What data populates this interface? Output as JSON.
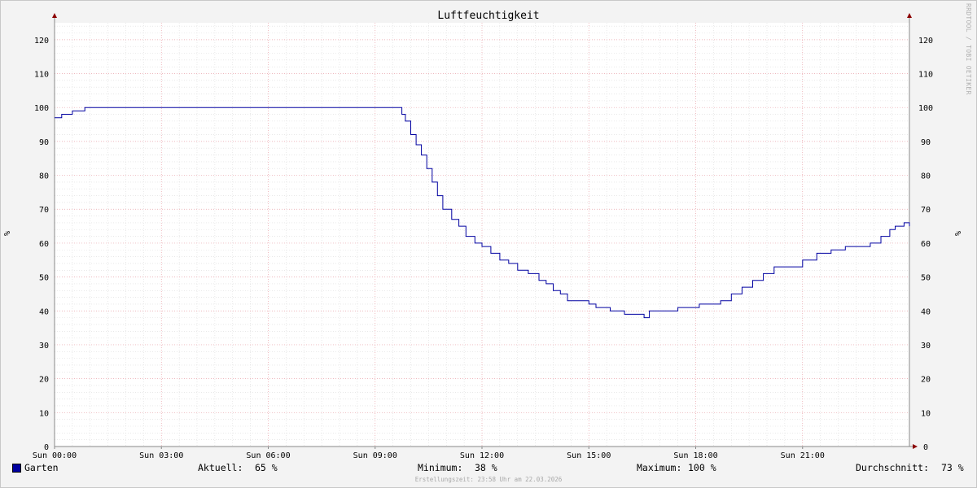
{
  "chart_data": {
    "type": "line",
    "title": "Luftfeuchtigkeit",
    "ylabel": "%",
    "ylabel_right": "%",
    "xlim_hours": [
      0,
      24
    ],
    "ylim": [
      0,
      125
    ],
    "yticks": [
      0,
      10,
      20,
      30,
      40,
      50,
      60,
      70,
      80,
      90,
      100,
      110,
      120
    ],
    "xticks": [
      {
        "hour": 0,
        "label": "Sun 00:00"
      },
      {
        "hour": 3,
        "label": "Sun 03:00"
      },
      {
        "hour": 6,
        "label": "Sun 06:00"
      },
      {
        "hour": 9,
        "label": "Sun 09:00"
      },
      {
        "hour": 12,
        "label": "Sun 12:00"
      },
      {
        "hour": 15,
        "label": "Sun 15:00"
      },
      {
        "hour": 18,
        "label": "Sun 18:00"
      },
      {
        "hour": 21,
        "label": "Sun 21:00"
      }
    ],
    "grid": true,
    "series": [
      {
        "name": "Garten",
        "color": "#0000a0",
        "points": [
          [
            0,
            97
          ],
          [
            0.15,
            97
          ],
          [
            0.2,
            98
          ],
          [
            0.45,
            98
          ],
          [
            0.5,
            99
          ],
          [
            0.8,
            99
          ],
          [
            0.85,
            100
          ],
          [
            9.65,
            100
          ],
          [
            9.75,
            98
          ],
          [
            9.85,
            96
          ],
          [
            10.0,
            92
          ],
          [
            10.15,
            89
          ],
          [
            10.3,
            86
          ],
          [
            10.45,
            82
          ],
          [
            10.6,
            78
          ],
          [
            10.75,
            74
          ],
          [
            10.9,
            70
          ],
          [
            11.0,
            70
          ],
          [
            11.15,
            67
          ],
          [
            11.35,
            65
          ],
          [
            11.55,
            62
          ],
          [
            11.8,
            60
          ],
          [
            12.0,
            59
          ],
          [
            12.25,
            57
          ],
          [
            12.5,
            55
          ],
          [
            12.75,
            54
          ],
          [
            13.0,
            52
          ],
          [
            13.3,
            51
          ],
          [
            13.6,
            49
          ],
          [
            13.8,
            48
          ],
          [
            14.0,
            46
          ],
          [
            14.2,
            45
          ],
          [
            14.4,
            43
          ],
          [
            14.7,
            43
          ],
          [
            15.0,
            42
          ],
          [
            15.2,
            41
          ],
          [
            15.45,
            41
          ],
          [
            15.6,
            40
          ],
          [
            16.0,
            39
          ],
          [
            16.45,
            39
          ],
          [
            16.55,
            38
          ],
          [
            16.7,
            40
          ],
          [
            17.0,
            40
          ],
          [
            17.5,
            41
          ],
          [
            17.9,
            41
          ],
          [
            18.1,
            42
          ],
          [
            18.4,
            42
          ],
          [
            18.7,
            43
          ],
          [
            19.0,
            45
          ],
          [
            19.3,
            47
          ],
          [
            19.6,
            49
          ],
          [
            19.9,
            51
          ],
          [
            20.2,
            53
          ],
          [
            20.6,
            53
          ],
          [
            21.0,
            55
          ],
          [
            21.4,
            57
          ],
          [
            21.8,
            58
          ],
          [
            22.2,
            59
          ],
          [
            22.6,
            59
          ],
          [
            22.9,
            60
          ],
          [
            23.2,
            62
          ],
          [
            23.45,
            64
          ],
          [
            23.6,
            65
          ],
          [
            23.85,
            66
          ],
          [
            24.0,
            65
          ]
        ]
      }
    ]
  },
  "legend": {
    "series_name": "Garten",
    "current_label": "Aktuell:",
    "current_value": "65 %",
    "minimum_label": "Minimum:",
    "minimum_value": "38 %",
    "maximum_label": "Maximum:",
    "maximum_value": "100 %",
    "average_label": "Durchschnitt:",
    "average_value": "73 %"
  },
  "footer_text": "Erstellungszeit: 23:58 Uhr am 22.03.2026",
  "watermark": "RRDTOOL / TOBI OETIKER"
}
